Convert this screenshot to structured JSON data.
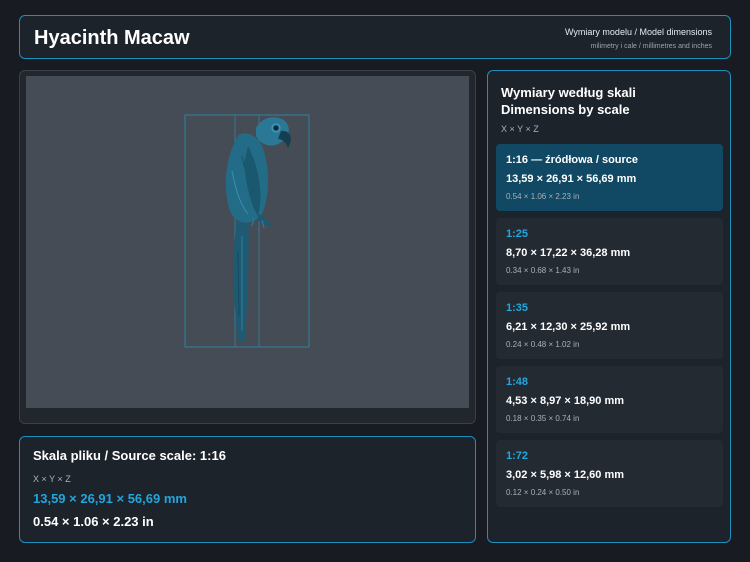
{
  "header": {
    "title": "Hyacinth Macaw",
    "subtitle_line1": "Wymiary modelu / Model dimensions",
    "subtitle_line2": "milimetry i cale / millimetres and inches"
  },
  "viewer": {
    "model_icon": "macaw-model-icon",
    "bounding_box_color": "#2a8fb0",
    "background_color": "#464c56"
  },
  "source": {
    "title": "Skala pliku / Source scale: 1:16",
    "axes": "X × Y × Z",
    "mm": "13,59 × 26,91 × 56,69 mm",
    "inches": "0.54 × 1.06 × 2.23 in"
  },
  "scales": {
    "title_line1": "Wymiary według skali",
    "title_line2": "Dimensions by scale",
    "axes": "X × Y × Z",
    "items": [
      {
        "ratio": "1:16  —  źródłowa / source",
        "mm": "13,59 × 26,91 × 56,69 mm",
        "inches": "0.54 × 1.06 × 2.23 in",
        "selected": true
      },
      {
        "ratio": "1:25",
        "mm": "8,70 × 17,22 × 36,28 mm",
        "inches": "0.34 × 0.68 × 1.43 in",
        "selected": false
      },
      {
        "ratio": "1:35",
        "mm": "6,21 × 12,30 × 25,92 mm",
        "inches": "0.24 × 0.48 × 1.02 in",
        "selected": false
      },
      {
        "ratio": "1:48",
        "mm": "4,53 × 8,97 × 18,90 mm",
        "inches": "0.18 × 0.35 × 0.74 in",
        "selected": false
      },
      {
        "ratio": "1:72",
        "mm": "3,02 × 5,98 × 12,60 mm",
        "inches": "0.12 × 0.24 × 0.50 in",
        "selected": false
      }
    ]
  },
  "colors": {
    "accent": "#22a6de",
    "selected_card": "#114863",
    "panel_border": "#1d8fbd"
  }
}
